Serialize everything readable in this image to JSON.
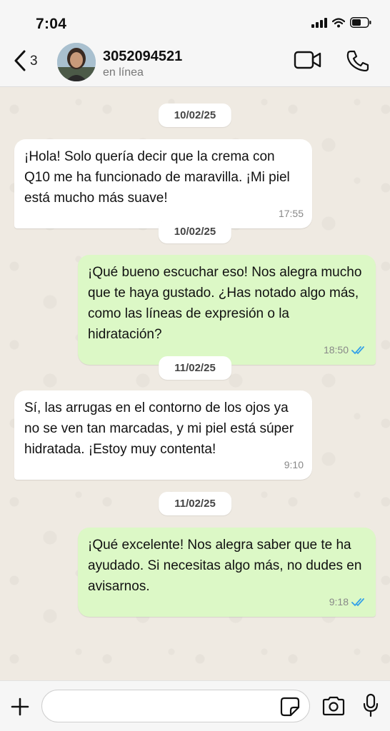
{
  "status_bar": {
    "time": "7:04"
  },
  "header": {
    "back_count": "3",
    "contact_name": "3052094521",
    "contact_status": "en línea"
  },
  "messages": [
    {
      "type": "date",
      "text": "10/02/25"
    },
    {
      "type": "in",
      "text": "¡Hola! Solo quería decir que la crema con Q10 me ha funcionado de maravilla. ¡Mi piel está mucho más suave!",
      "time": "17:55"
    },
    {
      "type": "date",
      "text": "10/02/25"
    },
    {
      "type": "out",
      "text": "¡Qué bueno escuchar eso! Nos alegra mucho que te haya gustado. ¿Has notado algo más, como las líneas de expresión o la hidratación?",
      "time": "18:50",
      "status": "read"
    },
    {
      "type": "date",
      "text": "11/02/25"
    },
    {
      "type": "in",
      "text": "Sí, las arrugas en el contorno de los ojos ya no se ven tan marcadas, y mi piel está súper hidratada. ¡Estoy muy contenta!",
      "time": "9:10"
    },
    {
      "type": "date",
      "text": "11/02/25"
    },
    {
      "type": "out",
      "text": "¡Qué excelente! Nos alegra saber que te ha ayudado. Si necesitas algo más, no dudes en avisarnos.",
      "time": "9:18",
      "status": "read"
    }
  ],
  "composer": {
    "value": ""
  },
  "colors": {
    "incoming_bubble": "#ffffff",
    "outgoing_bubble": "#dcf8c6",
    "read_ticks": "#34a0e8",
    "chat_background": "#efeae2"
  }
}
